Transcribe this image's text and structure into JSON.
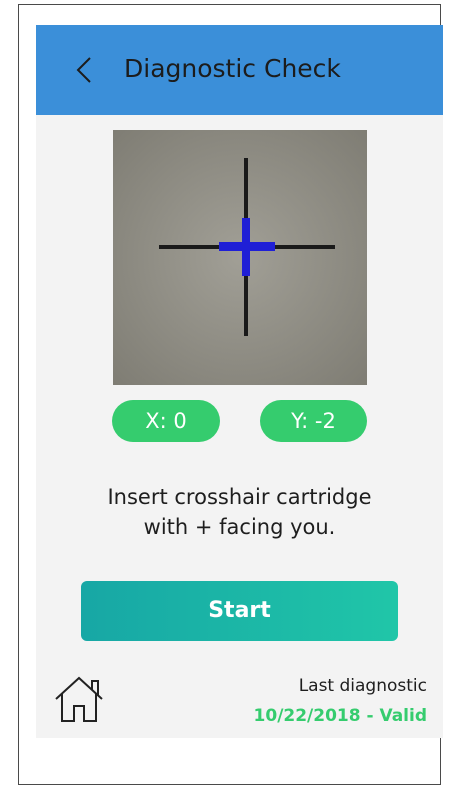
{
  "header": {
    "title": "Diagnostic Check",
    "back_icon": "chevron-left-icon"
  },
  "camera": {
    "description_icon": "crosshair-target"
  },
  "coordinates": {
    "x_label": "X: 0",
    "y_label": "Y: -2"
  },
  "instruction": {
    "line1": "Insert crosshair cartridge",
    "line2": "with + facing you."
  },
  "actions": {
    "start_label": "Start"
  },
  "footer": {
    "home_icon": "home-icon",
    "last_diagnostic_label": "Last diagnostic",
    "last_diagnostic_value": "10/22/2018 - Valid"
  },
  "colors": {
    "header": "#3b8fd9",
    "pill": "#35cc6e",
    "start_gradient_left": "#17a7a5",
    "start_gradient_right": "#20c6a8",
    "status_valid": "#35cc6e",
    "crosshair_overlay": "#1f1fd6"
  }
}
